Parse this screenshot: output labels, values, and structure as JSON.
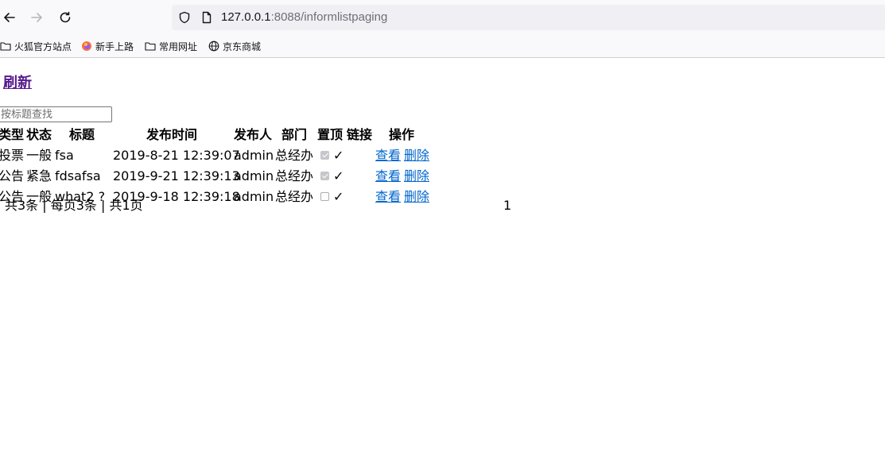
{
  "browser": {
    "url_host": "127.0.0.1",
    "url_rest": ":8088/informlistpaging",
    "bookmarks": [
      "火狐官方站点",
      "新手上路",
      "常用网址",
      "京东商城"
    ]
  },
  "page": {
    "refresh_label": "刷新",
    "search_placeholder": "按标题查找",
    "table": {
      "headers": [
        "类型",
        "状态",
        "标题",
        "发布时间",
        "发布人",
        "部门",
        "置顶",
        "链接",
        "操作"
      ],
      "rows": [
        {
          "type": "投票",
          "status": "一般",
          "title": "fsa",
          "time": "2019-8-21 12:39:07",
          "publisher": "admin",
          "dept": "总经办",
          "pinned": true,
          "link": "✓",
          "view": "查看",
          "delete": "删除"
        },
        {
          "type": "公告",
          "status": "紧急",
          "title": "fdsafsa",
          "time": "2019-9-21 12:39:13",
          "publisher": "admin",
          "dept": "总经办",
          "pinned": true,
          "link": "✓",
          "view": "查看",
          "delete": "删除"
        },
        {
          "type": "公告",
          "status": "一般",
          "title": "what2 ?",
          "time": "2019-9-18 12:39:18",
          "publisher": "admin",
          "dept": "总经办",
          "pinned": false,
          "link": "✓",
          "view": "查看",
          "delete": "删除"
        }
      ]
    },
    "pager": {
      "summary": "共3条 | 每页3条 | 共1页",
      "current": "1"
    }
  }
}
